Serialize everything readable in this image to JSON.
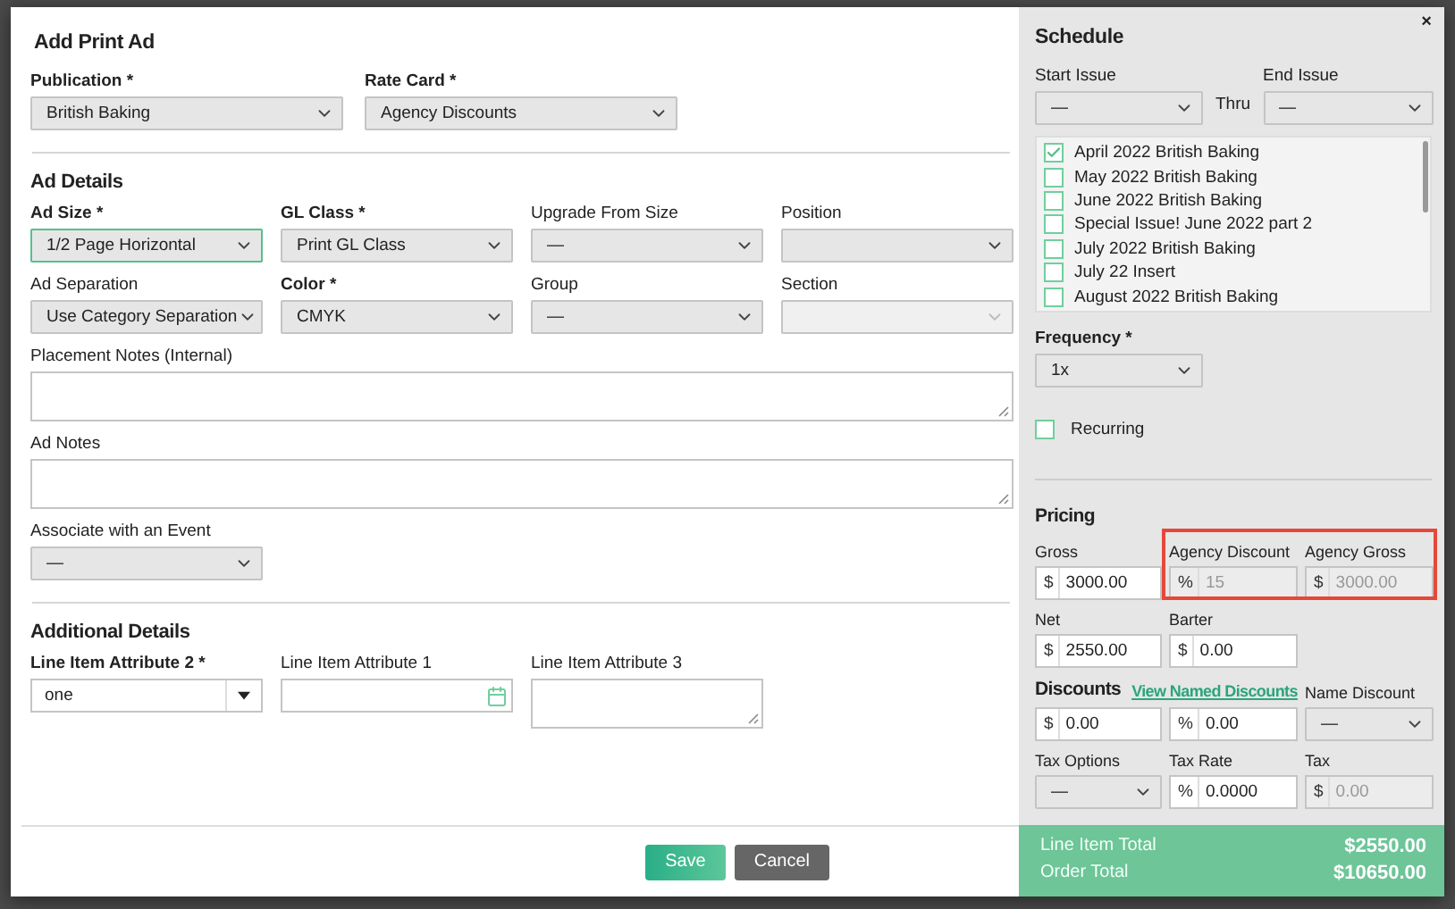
{
  "dialog": {
    "title": "Add Print Ad",
    "close": "×"
  },
  "sections": [
    {
      "kind": "basic",
      "rows": [
        {
          "fields": [
            {
              "kind": "select",
              "label": "Publication *",
              "required": true,
              "value": "British Baking",
              "focused": false,
              "disabled": false
            },
            {
              "kind": "select",
              "label": "Rate Card *",
              "required": true,
              "value": "Agency Discounts",
              "focused": false,
              "disabled": false
            }
          ]
        }
      ]
    },
    {
      "kind": "grid",
      "title": "Ad Details",
      "rows": [
        {
          "fields": [
            {
              "kind": "select",
              "label": "Ad Size *",
              "required": true,
              "value": "1/2 Page Horizontal",
              "focused": true,
              "disabled": false
            },
            {
              "kind": "select",
              "label": "GL Class *",
              "required": true,
              "value": "Print GL Class",
              "focused": false,
              "disabled": false
            },
            {
              "kind": "select",
              "label": "Upgrade From Size",
              "required": false,
              "value": "—",
              "focused": false,
              "disabled": false
            },
            {
              "kind": "select",
              "label": "Position",
              "required": false,
              "focused": false,
              "disabled": false
            }
          ]
        },
        {
          "fields": [
            {
              "kind": "select",
              "label": "Ad Separation",
              "required": false,
              "value": "Use Category Separation",
              "focused": false,
              "disabled": false
            },
            {
              "kind": "select",
              "label": "Color *",
              "required": true,
              "value": "CMYK",
              "focused": false,
              "disabled": false
            },
            {
              "kind": "select",
              "label": "Group",
              "required": false,
              "value": "—",
              "focused": false,
              "disabled": false
            },
            {
              "kind": "select",
              "label": "Section",
              "required": false,
              "focused": false,
              "disabled": true
            }
          ]
        },
        {
          "fields": [
            {
              "kind": "notes",
              "label": "Placement Notes (Internal)",
              "required": false
            }
          ]
        },
        {
          "fields": [
            {
              "kind": "notes",
              "label": "Ad Notes",
              "required": false
            }
          ]
        },
        {
          "fields": [
            {
              "kind": "select",
              "label": "Associate with an Event",
              "required": false,
              "value": "—",
              "focused": false,
              "disabled": false
            }
          ]
        }
      ]
    },
    {
      "kind": "grid",
      "title": "Additional Details",
      "rows": [
        {
          "fields": [
            {
              "kind": "combo",
              "label": "Line Item Attribute 2 *",
              "required": true,
              "value": "one"
            },
            {
              "kind": "date",
              "label": "Line Item Attribute 1",
              "required": false
            },
            {
              "kind": "memo",
              "label": "Line Item Attribute 3",
              "required": false
            }
          ]
        }
      ]
    }
  ],
  "buttons": [
    {
      "kind": "primary",
      "label": "Save"
    },
    {
      "kind": "secondary",
      "label": "Cancel"
    }
  ],
  "schedule": {
    "title": "Schedule",
    "start": {
      "label": "Start Issue",
      "value": "—"
    },
    "thru": "Thru",
    "end": {
      "label": "End Issue",
      "value": "—"
    },
    "issues": [
      {
        "label": "April 2022 British Baking",
        "checked": true
      },
      {
        "label": "May 2022 British Baking",
        "checked": false
      },
      {
        "label": "June 2022 British Baking",
        "checked": false
      },
      {
        "label": "Special Issue! June 2022 part 2",
        "checked": false
      },
      {
        "label": "July 2022 British Baking",
        "checked": false
      },
      {
        "label": "July 22 Insert",
        "checked": false
      },
      {
        "label": "August 2022 British Baking",
        "checked": false
      }
    ],
    "frequency": {
      "label": "Frequency *",
      "value": "1x"
    },
    "recurring": {
      "label": "Recurring",
      "checked": false
    }
  },
  "pricing": {
    "title": "Pricing",
    "rows": [
      {
        "highlighted": true,
        "fields": [
          {
            "kind": "amount",
            "label": "Gross",
            "prefix": "$",
            "value": "3000.00",
            "disabled": false
          },
          {
            "kind": "amount",
            "label": "Agency Discount",
            "prefix": "%",
            "value": "15",
            "disabled": true
          },
          {
            "kind": "amount",
            "label": "Agency Gross",
            "prefix": "$",
            "value": "3000.00",
            "disabled": true
          }
        ]
      },
      {
        "highlighted": false,
        "fields": [
          {
            "kind": "amount",
            "label": "Net",
            "prefix": "$",
            "value": "2550.00",
            "disabled": false
          },
          {
            "kind": "amount",
            "label": "Barter",
            "prefix": "$",
            "value": "0.00",
            "disabled": false
          }
        ]
      },
      {
        "highlighted": false,
        "heading": "Discounts",
        "link": "View Named Discounts",
        "fields": [
          {
            "kind": "amount",
            "prefix": "$",
            "value": "0.00",
            "disabled": false
          },
          {
            "kind": "amount",
            "prefix": "%",
            "value": "0.00",
            "disabled": false
          },
          {
            "kind": "select",
            "label": "Name Discount",
            "value": "—"
          }
        ]
      },
      {
        "highlighted": false,
        "fields": [
          {
            "kind": "select",
            "label": "Tax Options",
            "value": "—"
          },
          {
            "kind": "amount",
            "label": "Tax Rate",
            "prefix": "%",
            "value": "0.0000",
            "disabled": false
          },
          {
            "kind": "amount",
            "label": "Tax",
            "prefix": "$",
            "value": "0.00",
            "disabled": true
          }
        ]
      }
    ]
  },
  "totals": [
    {
      "label": "Line Item Total",
      "value": "$2550.00"
    },
    {
      "label": "Order Total",
      "value": "$10650.00"
    }
  ]
}
